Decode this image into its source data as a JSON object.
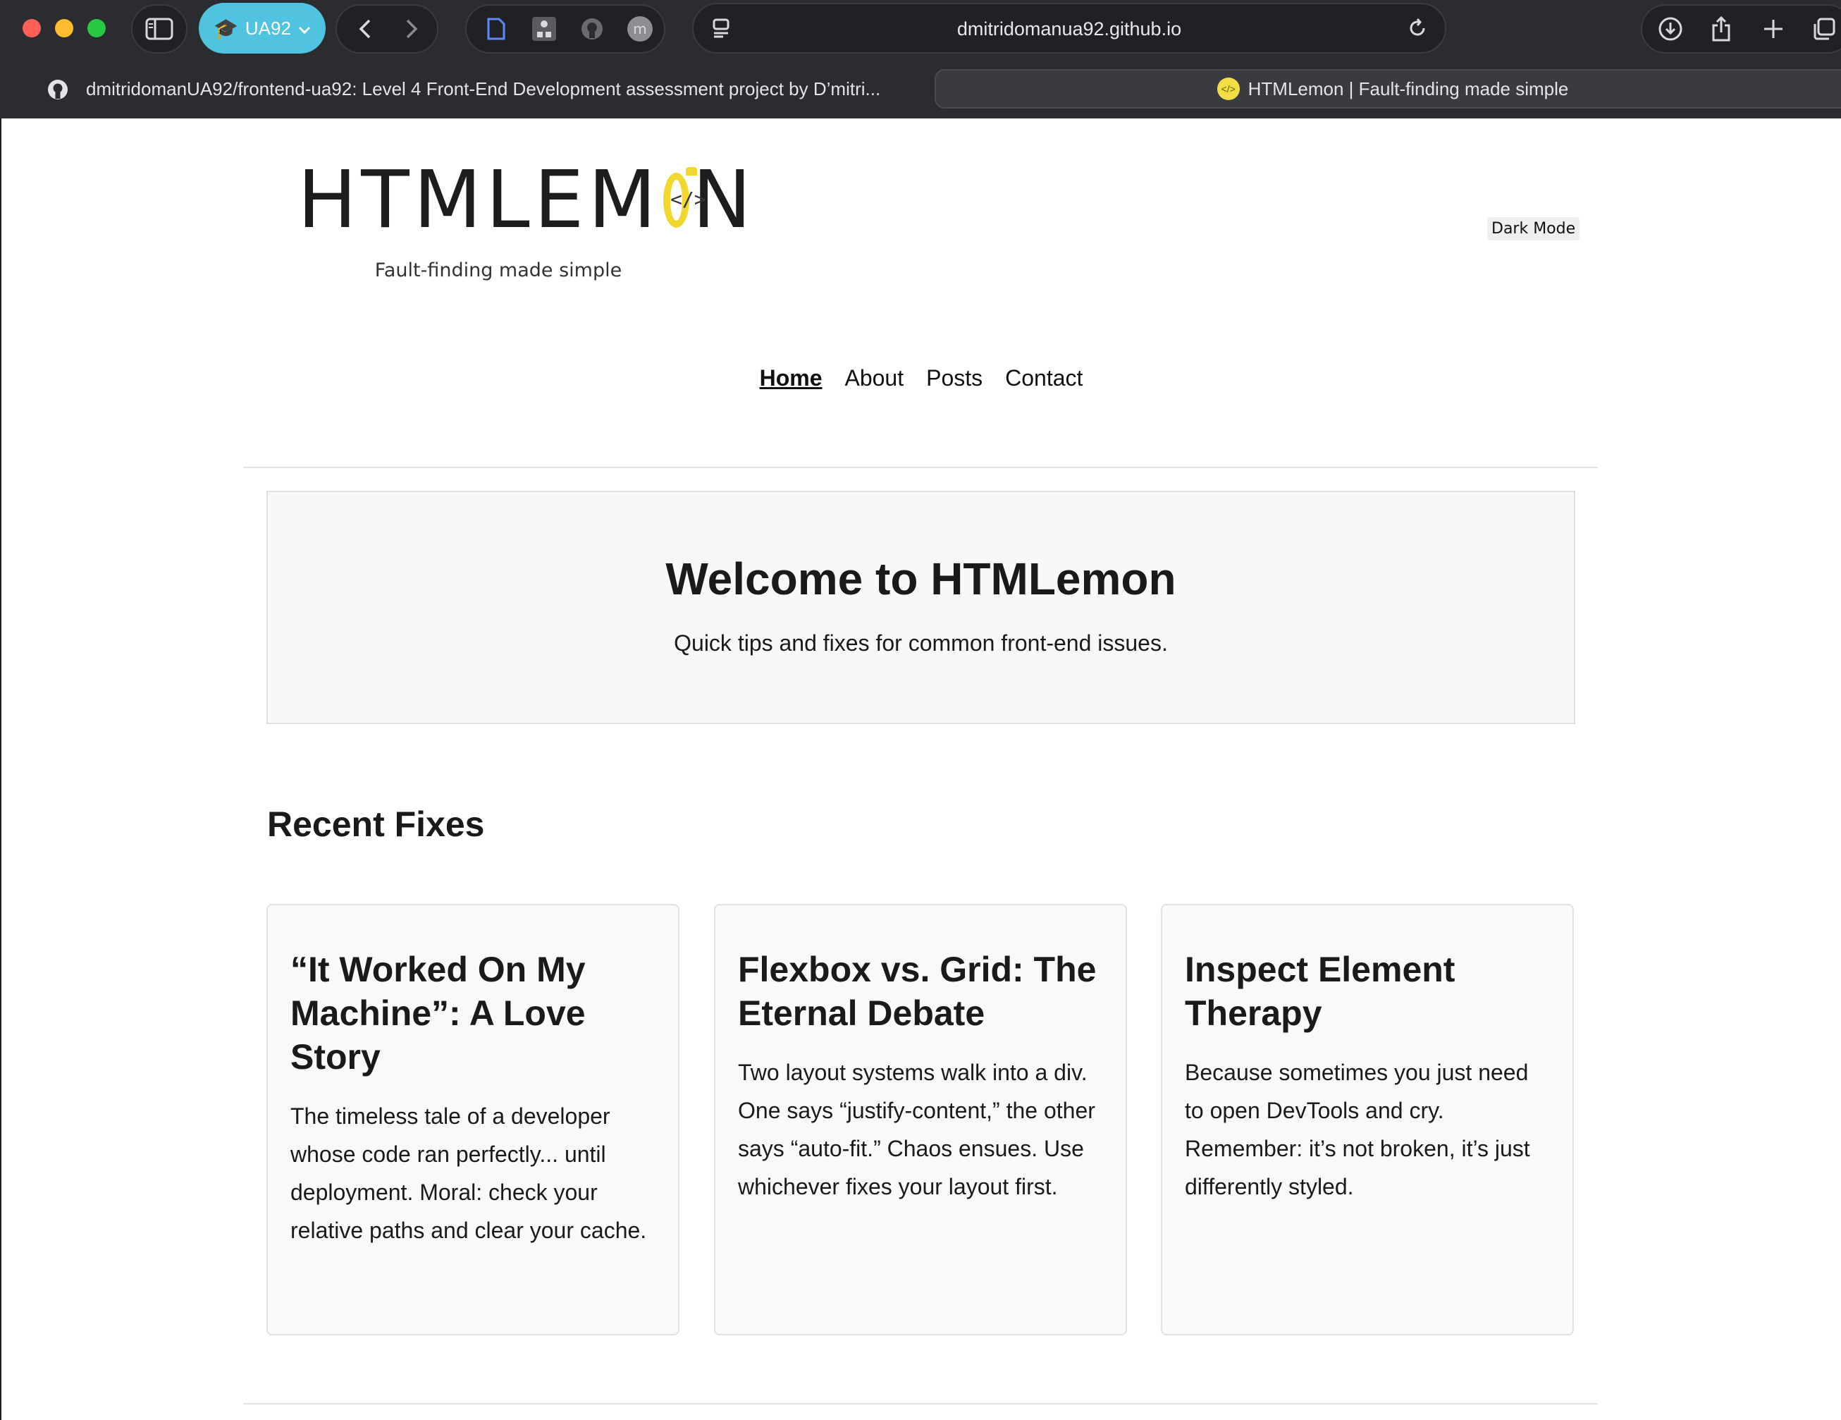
{
  "browser": {
    "profile_label": "UA92",
    "address": "dmitridomanua92.github.io",
    "tabs": [
      {
        "title": "dmitridomanUA92/frontend-ua92: Level 4 Front-End Development assessment project by D’mitri..."
      },
      {
        "title": "HTMLemon | Fault-finding made simple"
      }
    ],
    "icons": [
      "sidebar-icon",
      "graduation-cap-icon",
      "back-icon",
      "forward-icon",
      "page-icon",
      "org-chart-icon",
      "github-icon",
      "avatar-icon",
      "reader-icon",
      "reload-icon",
      "download-icon",
      "share-icon",
      "new-tab-icon",
      "tabs-overview-icon"
    ]
  },
  "site": {
    "logo_text_left": "HTMLEM",
    "logo_text_right": "N",
    "logo_code_glyph": "</>",
    "tagline": "Fault-finding made simple",
    "dark_mode_label": "Dark Mode",
    "nav": [
      {
        "label": "Home",
        "active": true
      },
      {
        "label": "About",
        "active": false
      },
      {
        "label": "Posts",
        "active": false
      },
      {
        "label": "Contact",
        "active": false
      }
    ],
    "hero": {
      "title": "Welcome to HTMLemon",
      "subtitle": "Quick tips and fixes for common front-end issues."
    },
    "section_title": "Recent Fixes",
    "cards": [
      {
        "title": "“It Worked On My Machine”: A Love Story",
        "body": "The timeless tale of a developer whose code ran perfectly... until deployment. Moral: check your relative paths and clear your cache."
      },
      {
        "title": "Flexbox vs. Grid: The Eternal Debate",
        "body": "Two layout systems walk into a div. One says “justify-content,” the other says “auto-fit.” Chaos ensues. Use whichever fixes your layout first."
      },
      {
        "title": "Inspect Element Therapy",
        "body": "Because sometimes you just need to open DevTools and cry. Remember: it’s not broken, it’s just differently styled."
      }
    ]
  },
  "colors": {
    "accent_lemon": "#f1d72f",
    "profile_pill": "#4fc3e0",
    "chrome_bg": "#2b2c30"
  }
}
